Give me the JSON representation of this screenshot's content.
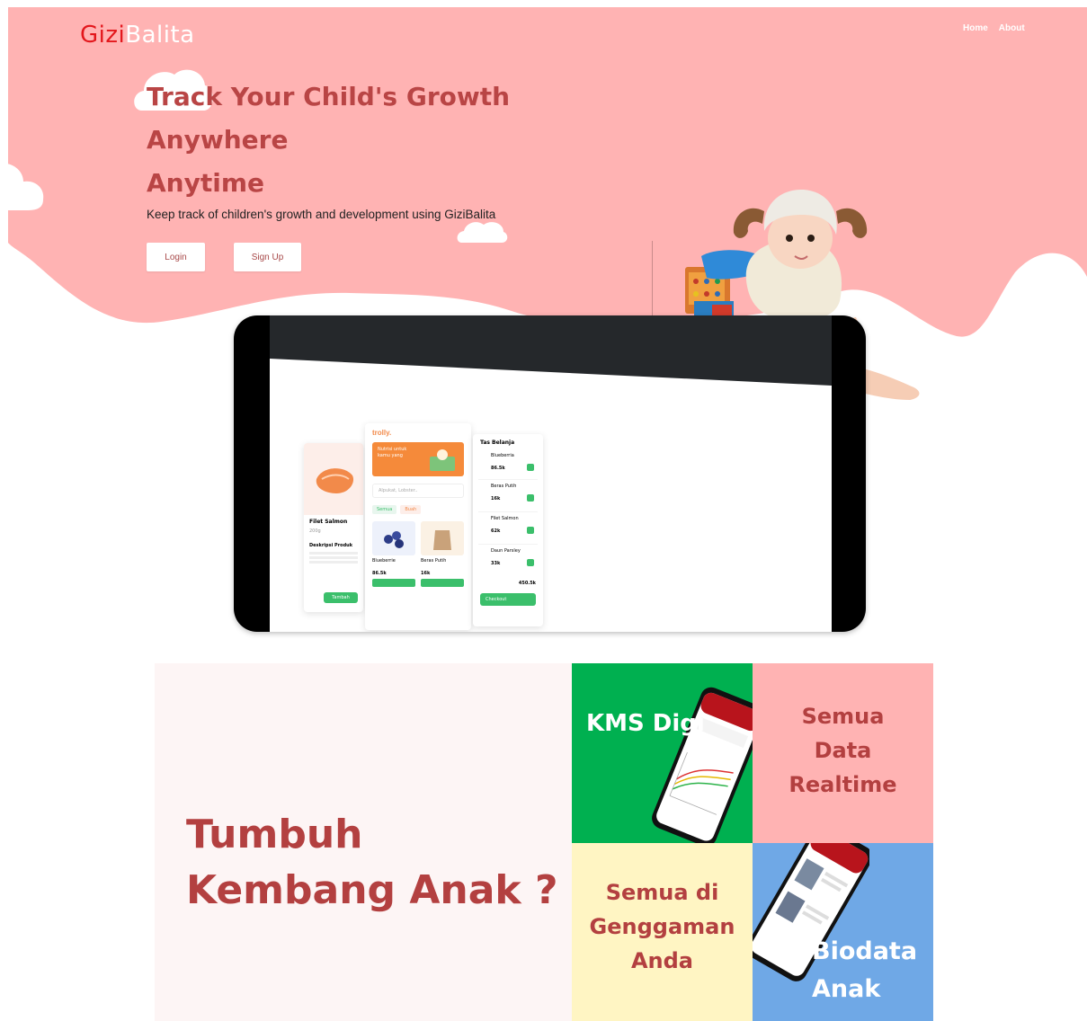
{
  "header": {
    "logo_part1": "Gizi",
    "logo_part2": "Balita",
    "nav": [
      "Home",
      "About"
    ]
  },
  "hero": {
    "headline_line1": "Track Your Child's Growth",
    "headline_line2": "Anywhere",
    "headline_line3": "Anytime",
    "subtitle": "Keep track of children's growth and development using GiziBalita",
    "login_label": "Login",
    "signup_label": "Sign Up"
  },
  "mockup": {
    "brand": "trolly.",
    "cart_title": "Tas Belanja",
    "search_placeholder": "Alpukat, Lobster..",
    "chip_all": "Semua",
    "chip_2": "Buah",
    "product_title": "Filet Salmon",
    "product_weight": "200g",
    "product_desc_title": "Deskripsi Produk",
    "banner_text_1": "Nutrisi untuk",
    "banner_text_2": "kamu yang",
    "grid_item_1": "Blueberrie",
    "grid_item_1_price": "86.5k",
    "grid_item_2": "Beras Putih",
    "grid_item_2_price": "16k",
    "cart_items": [
      {
        "name": "Blueberria",
        "price": "86.5k"
      },
      {
        "name": "Beras Putih",
        "price": "16k"
      },
      {
        "name": "Filet Salmon",
        "price": "62k"
      },
      {
        "name": "Daun Parsley",
        "price": "33k"
      }
    ],
    "cart_total": "450.5k",
    "checkout_label": "Checkout",
    "add_to_cart": "Tambah"
  },
  "features": {
    "title_line1": "Tumbuh",
    "title_line2": "Kembang Anak ?",
    "tile_kms": "KMS Digi",
    "tile_realtime_1": "Semua",
    "tile_realtime_2": "Data",
    "tile_realtime_3": "Realtime",
    "tile_hand_1": "Semua di",
    "tile_hand_2": "Genggaman",
    "tile_hand_3": "Anda",
    "tile_bio_1": "Biodata",
    "tile_bio_2": "Anak"
  },
  "colors": {
    "hero_pink": "#ffb3b3",
    "headline_red": "#b94545",
    "logo_red": "#e3171c",
    "tile_green": "#00b050",
    "tile_yellow": "#fff5c3",
    "tile_blue": "#6fa8e6"
  }
}
